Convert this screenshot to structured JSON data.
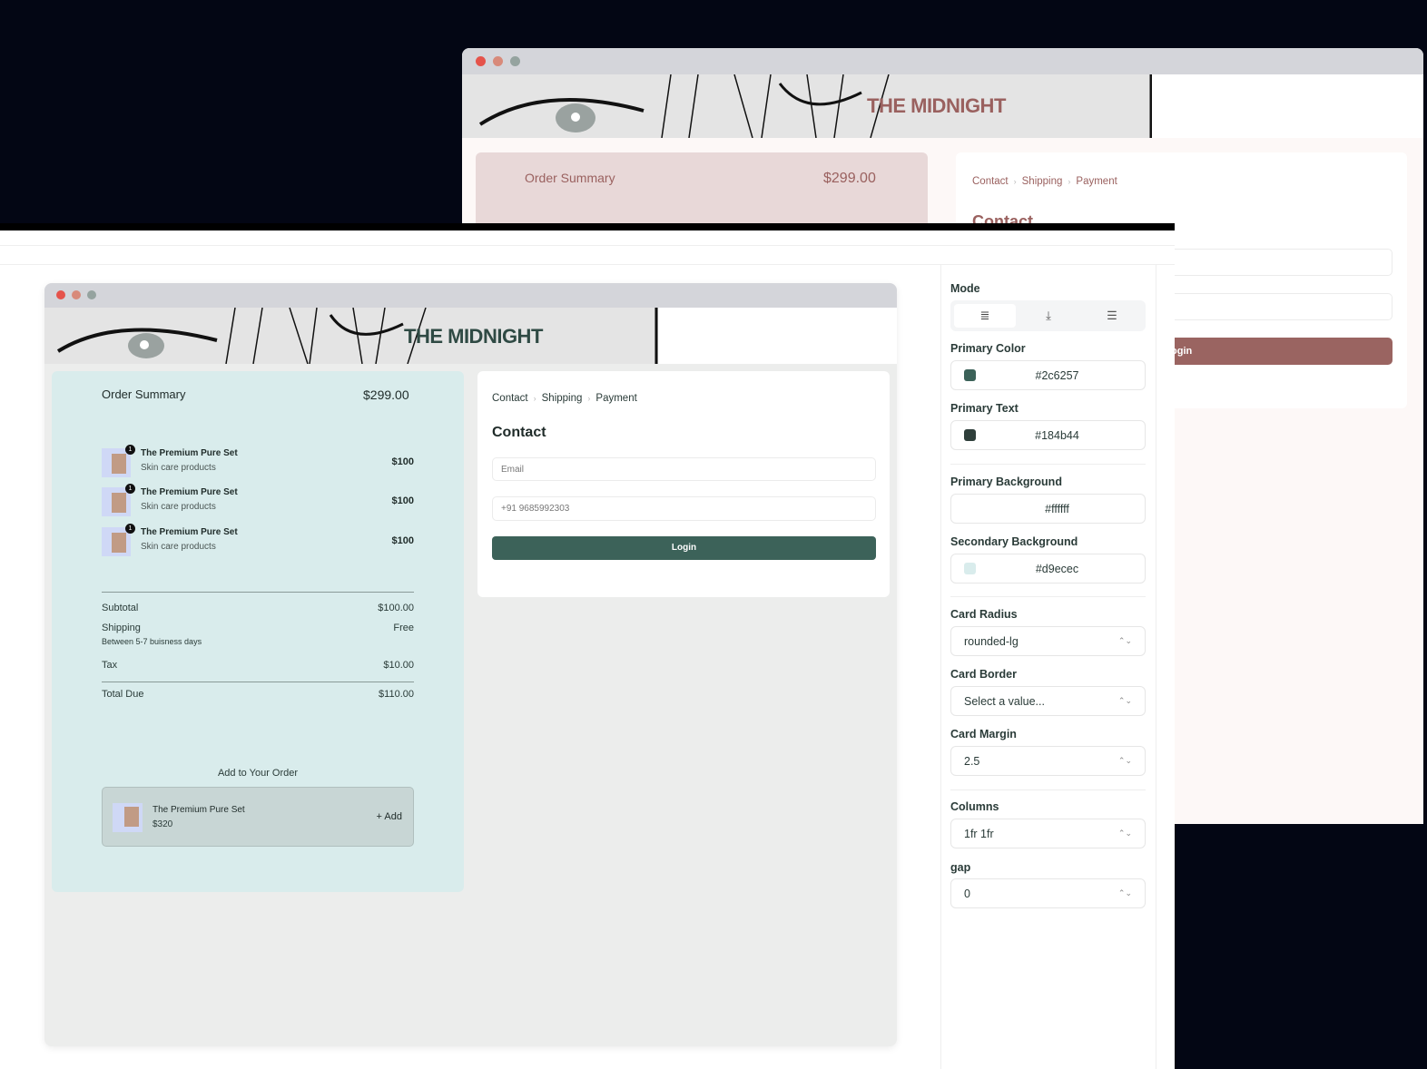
{
  "brand": "THE MIDNIGHT",
  "colors": {
    "primary": "#2c6257",
    "primary_text": "#184b44",
    "rose_primary": "#9a6461",
    "rose_bg": "#e8d8d8",
    "secondary_bg": "#d9ecec"
  },
  "back_window": {
    "order_summary": {
      "title": "Order Summary",
      "total": "$299.00"
    },
    "breadcrumb": [
      "Contact",
      "Shipping",
      "Payment"
    ],
    "contact_title": "Contact",
    "login_label": "ogin"
  },
  "preview": {
    "order_summary": {
      "title": "Order Summary",
      "total": "$299.00",
      "items": [
        {
          "qty": "1",
          "name": "The Premium Pure Set",
          "desc": "Skin care products",
          "price": "$100"
        },
        {
          "qty": "1",
          "name": "The Premium Pure Set",
          "desc": "Skin care products",
          "price": "$100"
        },
        {
          "qty": "1",
          "name": "The Premium Pure Set",
          "desc": "Skin care products",
          "price": "$100"
        }
      ],
      "subtotal_label": "Subtotal",
      "subtotal": "$100.00",
      "shipping_label": "Shipping",
      "shipping": "Free",
      "shipping_note": "Between 5-7 buisness days",
      "tax_label": "Tax",
      "tax": "$10.00",
      "total_label": "Total Due",
      "total_due": "$110.00",
      "upsell_title": "Add to Your Order",
      "upsell": {
        "name": "The Premium Pure Set",
        "price": "$320",
        "add_label": "+ Add"
      }
    },
    "checkout": {
      "breadcrumb": [
        "Contact",
        "Shipping",
        "Payment"
      ],
      "title": "Contact",
      "email_placeholder": "Email",
      "phone_value": "+91 9685992303",
      "login_label": "Login"
    }
  },
  "settings": {
    "mode_label": "Mode",
    "mode_icons": [
      "list-icon",
      "download-icon",
      "edit-list-icon"
    ],
    "primary_color_label": "Primary Color",
    "primary_color": "#2c6257",
    "primary_text_label": "Primary Text",
    "primary_text": "#184b44",
    "primary_bg_label": "Primary Background",
    "primary_bg": "#ffffff",
    "secondary_bg_label": "Secondary Background",
    "secondary_bg": "#d9ecec",
    "card_radius_label": "Card Radius",
    "card_radius": "rounded-lg",
    "card_border_label": "Card Border",
    "card_border": "Select a value...",
    "card_margin_label": "Card Margin",
    "card_margin": "2.5",
    "columns_label": "Columns",
    "columns": "1fr 1fr",
    "gap_label": "gap",
    "gap": "0"
  }
}
